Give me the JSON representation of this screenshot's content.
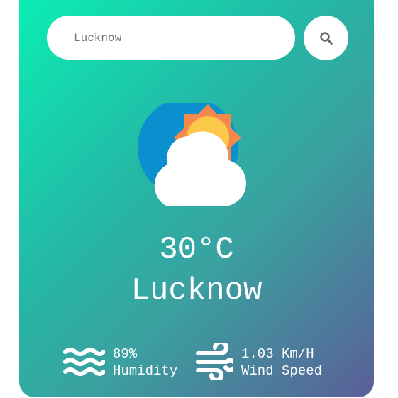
{
  "search": {
    "placeholder": "Lucknow",
    "button_icon": "search-icon"
  },
  "weather": {
    "icon": "partly-cloudy-icon",
    "temperature": "30°C",
    "city": "Lucknow"
  },
  "details": {
    "humidity": {
      "icon": "humidity-waves-icon",
      "value": "89%",
      "label": "Humidity"
    },
    "wind": {
      "icon": "wind-icon",
      "value": "1.03 Km/H",
      "label": "Wind Speed"
    }
  }
}
